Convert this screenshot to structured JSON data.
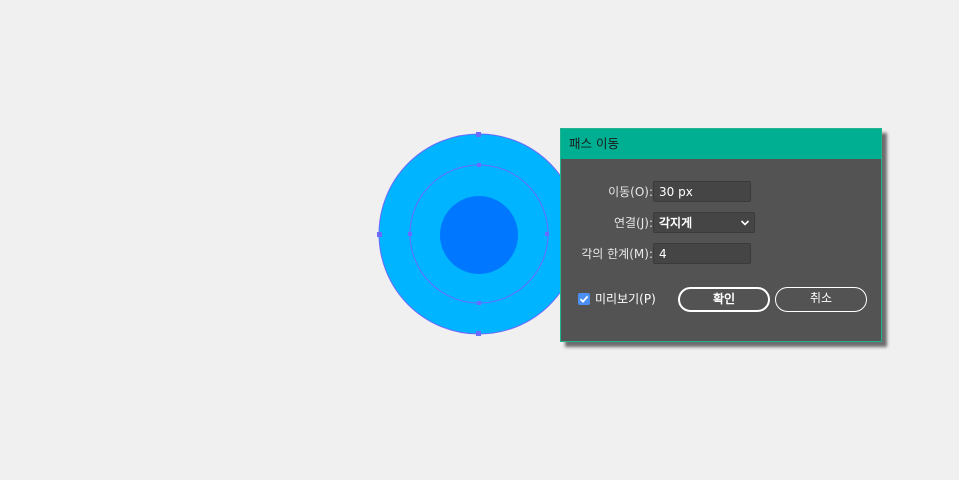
{
  "colors": {
    "canvas_bg": "#f0f0f0",
    "outer_circle": "#00b4ff",
    "inner_circle": "#0077ff",
    "path_stroke": "#6a6aff",
    "dialog_bg": "#535353",
    "titlebar_bg": "#00ae91",
    "checkbox": "#4c8ff2"
  },
  "dialog": {
    "title": "패스 이동",
    "offset": {
      "label": "이동(O):",
      "value": "30 px"
    },
    "joins": {
      "label": "연결(J):",
      "value": "각지게",
      "icon": "chevron-down-icon"
    },
    "miter_limit": {
      "label": "각의 한계(M):",
      "value": "4"
    },
    "preview": {
      "label": "미리보기(P)",
      "checked": true,
      "icon": "check-icon"
    },
    "ok_label": "확인",
    "cancel_label": "취소"
  }
}
